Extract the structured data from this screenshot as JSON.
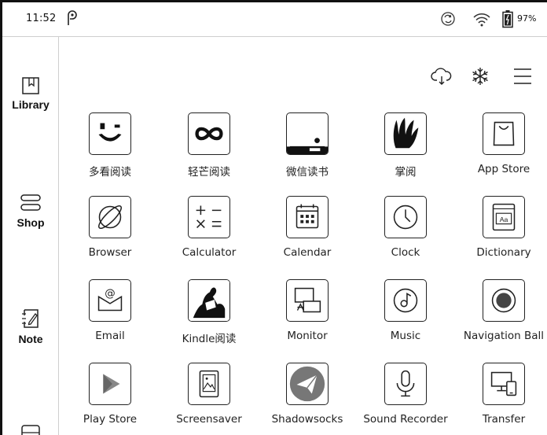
{
  "status_bar": {
    "time": "11:52",
    "battery_pct": "97%"
  },
  "sidebar": {
    "items": [
      {
        "label": "Library"
      },
      {
        "label": "Shop"
      },
      {
        "label": "Note"
      },
      {
        "label": ""
      }
    ]
  },
  "toolbar": {
    "icons": [
      "cloud-sync-icon",
      "freeze-icon",
      "menu-icon"
    ]
  },
  "apps": [
    {
      "label": "多看阅读"
    },
    {
      "label": "轻芒阅读"
    },
    {
      "label": "微信读书"
    },
    {
      "label": "掌阅"
    },
    {
      "label": "App Store"
    },
    {
      "label": "Browser"
    },
    {
      "label": "Calculator"
    },
    {
      "label": "Calendar"
    },
    {
      "label": "Clock"
    },
    {
      "label": "Dictionary"
    },
    {
      "label": "Email"
    },
    {
      "label": "Kindle阅读"
    },
    {
      "label": "Monitor"
    },
    {
      "label": "Music"
    },
    {
      "label": "Navigation Ball"
    },
    {
      "label": "Play Store"
    },
    {
      "label": "Screensaver"
    },
    {
      "label": "Shadowsocks"
    },
    {
      "label": "Sound Recorder"
    },
    {
      "label": "Transfer"
    }
  ]
}
